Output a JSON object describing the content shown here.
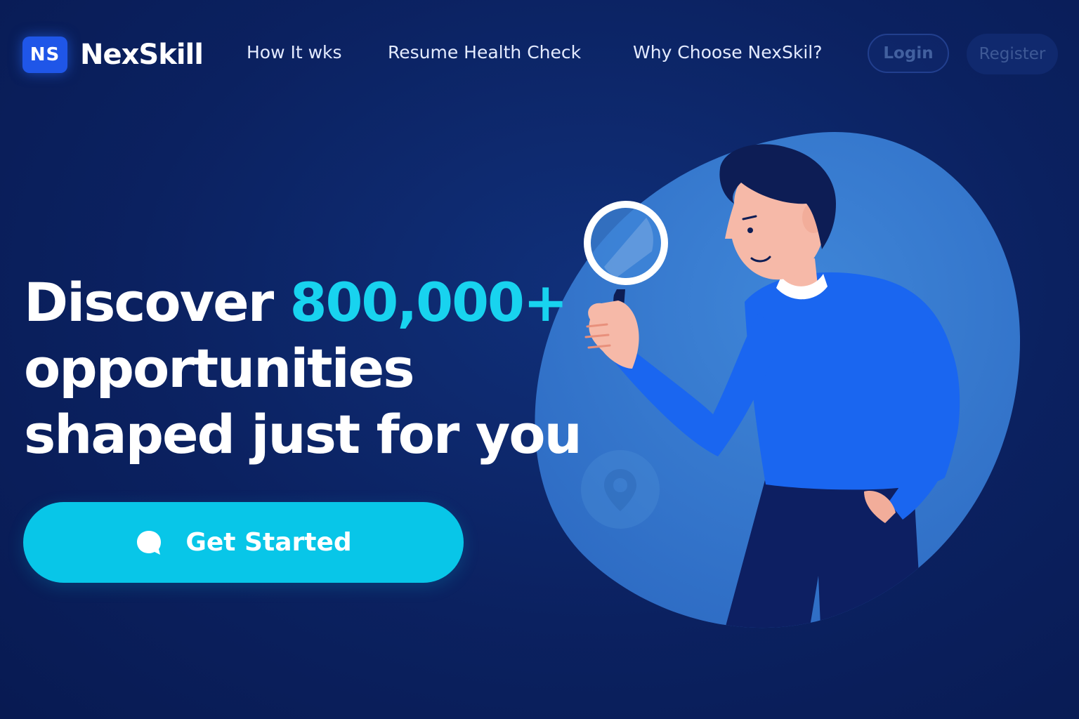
{
  "brand": {
    "badge": "NS",
    "name": "NexSkill"
  },
  "nav": {
    "items": [
      {
        "label": "How It wks"
      },
      {
        "label": "Resume Health Check"
      },
      {
        "label": "Why Choose NexSkil?"
      }
    ],
    "login_label": "Login",
    "register_label": "Register"
  },
  "hero": {
    "headline_part1": "Discover ",
    "headline_accent": "800,000+",
    "headline_line2": "opportunities",
    "headline_line3": "shaped just for you",
    "cta_label": "Get Started",
    "cta_icon": "chat-bubble-icon"
  },
  "illustration": {
    "subject": "person-with-magnifying-glass",
    "decorative_icon": "location-pin-icon"
  },
  "colors": {
    "background": "#0b2160",
    "accent": "#18d3ef",
    "cta": "#08c6e8",
    "brand_blue": "#1f56e8",
    "blob": "#3a7fd0",
    "sweater": "#1a66f0",
    "pants": "#0d1f62",
    "hair": "#0d1d55",
    "skin": "#f6b9a8"
  }
}
